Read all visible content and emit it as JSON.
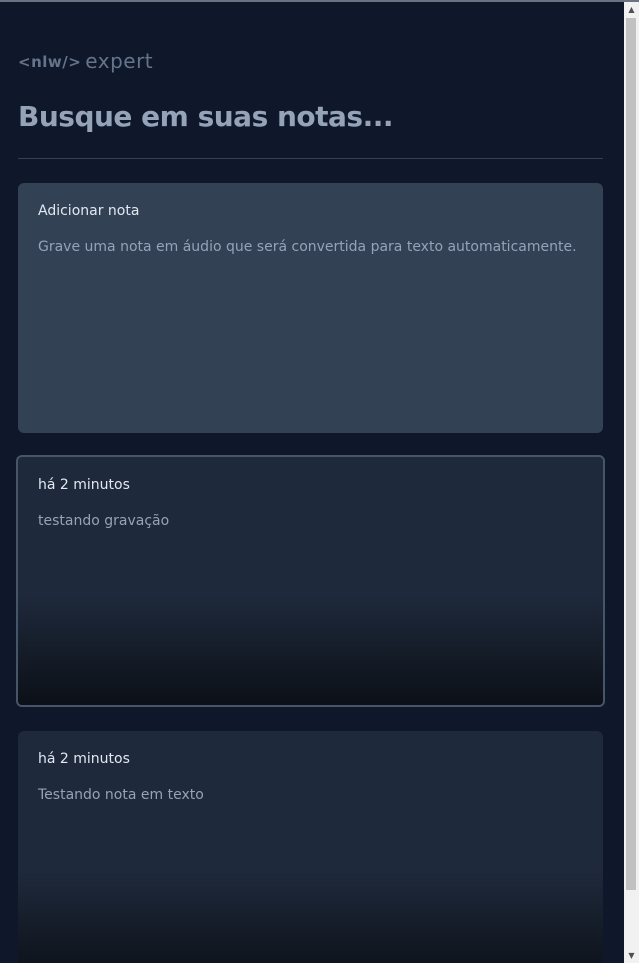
{
  "logo": {
    "code_text": "<nlw/>",
    "expert_text": "expert"
  },
  "search": {
    "placeholder": "Busque em suas notas..."
  },
  "new_note_card": {
    "title": "Adicionar nota",
    "description": "Grave uma nota em áudio que será convertida para texto automaticamente."
  },
  "notes": [
    {
      "date": "há 2 minutos",
      "content": "testando gravação"
    },
    {
      "date": "há 2 minutos",
      "content": "Testando nota em texto"
    }
  ],
  "colors": {
    "background": "#0f172a",
    "card_new": "#334155",
    "card_note": "#1e293b",
    "text_primary": "#e2e8f0",
    "text_muted": "#94a3b8"
  }
}
